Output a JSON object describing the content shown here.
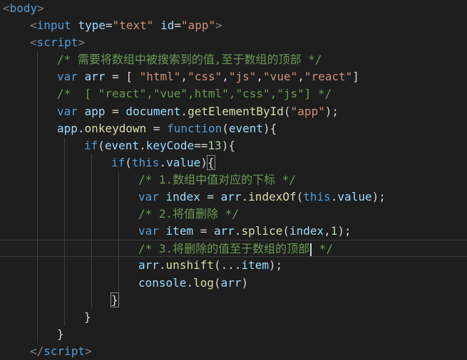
{
  "lines": [
    {
      "indent": 0,
      "tokens": [
        {
          "c": "t-punc",
          "v": "<"
        },
        {
          "c": "t-tag",
          "v": "body"
        },
        {
          "c": "t-punc",
          "v": ">"
        }
      ]
    },
    {
      "indent": 1,
      "tokens": [
        {
          "c": "t-punc",
          "v": "<"
        },
        {
          "c": "t-tag",
          "v": "input"
        },
        {
          "c": "t-plain",
          "v": " "
        },
        {
          "c": "t-attr",
          "v": "type"
        },
        {
          "c": "t-plain",
          "v": "="
        },
        {
          "c": "t-str",
          "v": "\"text\""
        },
        {
          "c": "t-plain",
          "v": " "
        },
        {
          "c": "t-attr",
          "v": "id"
        },
        {
          "c": "t-plain",
          "v": "="
        },
        {
          "c": "t-str",
          "v": "\"app\""
        },
        {
          "c": "t-punc",
          "v": ">"
        }
      ]
    },
    {
      "indent": 1,
      "tokens": [
        {
          "c": "t-punc",
          "v": "<"
        },
        {
          "c": "t-tag",
          "v": "script"
        },
        {
          "c": "t-punc",
          "v": ">"
        }
      ]
    },
    {
      "indent": 2,
      "tokens": [
        {
          "c": "t-cmt",
          "v": "/* 需要将数组中被搜索到的值,至于数组的顶部 */"
        }
      ]
    },
    {
      "indent": 2,
      "tokens": [
        {
          "c": "t-kw",
          "v": "var"
        },
        {
          "c": "t-plain",
          "v": " "
        },
        {
          "c": "t-var",
          "v": "arr"
        },
        {
          "c": "t-plain",
          "v": " = [ "
        },
        {
          "c": "t-str",
          "v": "\"html\""
        },
        {
          "c": "t-plain",
          "v": ","
        },
        {
          "c": "t-str",
          "v": "\"css\""
        },
        {
          "c": "t-plain",
          "v": ","
        },
        {
          "c": "t-str",
          "v": "\"js\""
        },
        {
          "c": "t-plain",
          "v": ","
        },
        {
          "c": "t-str",
          "v": "\"vue\""
        },
        {
          "c": "t-plain",
          "v": ","
        },
        {
          "c": "t-str",
          "v": "\"react\""
        },
        {
          "c": "t-plain",
          "v": "]"
        }
      ]
    },
    {
      "indent": 2,
      "tokens": [
        {
          "c": "t-cmt",
          "v": "/*  [ \"react\",\"vue\",html\",\"css\",\"js\"] */"
        }
      ]
    },
    {
      "indent": 2,
      "tokens": [
        {
          "c": "t-kw",
          "v": "var"
        },
        {
          "c": "t-plain",
          "v": " "
        },
        {
          "c": "t-var",
          "v": "app"
        },
        {
          "c": "t-plain",
          "v": " = "
        },
        {
          "c": "t-var",
          "v": "document"
        },
        {
          "c": "t-plain",
          "v": "."
        },
        {
          "c": "t-fn",
          "v": "getElementById"
        },
        {
          "c": "t-plain",
          "v": "("
        },
        {
          "c": "t-str",
          "v": "\"app\""
        },
        {
          "c": "t-plain",
          "v": ");"
        }
      ]
    },
    {
      "indent": 2,
      "tokens": [
        {
          "c": "t-var",
          "v": "app"
        },
        {
          "c": "t-plain",
          "v": "."
        },
        {
          "c": "t-fn",
          "v": "onkeydown"
        },
        {
          "c": "t-plain",
          "v": " = "
        },
        {
          "c": "t-kw",
          "v": "function"
        },
        {
          "c": "t-plain",
          "v": "("
        },
        {
          "c": "t-var",
          "v": "event"
        },
        {
          "c": "t-plain",
          "v": "){"
        }
      ]
    },
    {
      "indent": 3,
      "tokens": [
        {
          "c": "t-kw",
          "v": "if"
        },
        {
          "c": "t-plain",
          "v": "("
        },
        {
          "c": "t-var",
          "v": "event"
        },
        {
          "c": "t-plain",
          "v": "."
        },
        {
          "c": "t-var",
          "v": "keyCode"
        },
        {
          "c": "t-plain",
          "v": "=="
        },
        {
          "c": "t-num",
          "v": "13"
        },
        {
          "c": "t-plain",
          "v": "){"
        }
      ]
    },
    {
      "indent": 4,
      "tokens": [
        {
          "c": "t-kw",
          "v": "if"
        },
        {
          "c": "t-plain",
          "v": "("
        },
        {
          "c": "t-this",
          "v": "this"
        },
        {
          "c": "t-plain",
          "v": "."
        },
        {
          "c": "t-var",
          "v": "value"
        },
        {
          "c": "t-plain",
          "v": ")"
        },
        {
          "c": "t-plain bracket-box",
          "v": "{"
        }
      ]
    },
    {
      "indent": 5,
      "tokens": [
        {
          "c": "t-cmt",
          "v": "/* 1.数组中值对应的下标 */"
        }
      ]
    },
    {
      "indent": 5,
      "tokens": [
        {
          "c": "t-kw",
          "v": "var"
        },
        {
          "c": "t-plain",
          "v": " "
        },
        {
          "c": "t-var",
          "v": "index"
        },
        {
          "c": "t-plain",
          "v": " = "
        },
        {
          "c": "t-var",
          "v": "arr"
        },
        {
          "c": "t-plain",
          "v": "."
        },
        {
          "c": "t-fn",
          "v": "indexOf"
        },
        {
          "c": "t-plain",
          "v": "("
        },
        {
          "c": "t-this",
          "v": "this"
        },
        {
          "c": "t-plain",
          "v": "."
        },
        {
          "c": "t-var",
          "v": "value"
        },
        {
          "c": "t-plain",
          "v": ");"
        }
      ]
    },
    {
      "indent": 5,
      "tokens": [
        {
          "c": "t-cmt",
          "v": "/* 2.将值删除 */"
        }
      ]
    },
    {
      "indent": 5,
      "tokens": [
        {
          "c": "t-kw",
          "v": "var"
        },
        {
          "c": "t-plain",
          "v": " "
        },
        {
          "c": "t-var",
          "v": "item"
        },
        {
          "c": "t-plain",
          "v": " = "
        },
        {
          "c": "t-var",
          "v": "arr"
        },
        {
          "c": "t-plain",
          "v": "."
        },
        {
          "c": "t-fn",
          "v": "splice"
        },
        {
          "c": "t-plain",
          "v": "("
        },
        {
          "c": "t-var",
          "v": "index"
        },
        {
          "c": "t-plain",
          "v": ","
        },
        {
          "c": "t-num",
          "v": "1"
        },
        {
          "c": "t-plain",
          "v": ");"
        }
      ]
    },
    {
      "indent": 5,
      "current": true,
      "tokens": [
        {
          "c": "t-cmt",
          "v": "/* 3.将删除的值至于数组的顶部"
        },
        {
          "c": "cursor",
          "v": ""
        },
        {
          "c": "t-cmt",
          "v": " */"
        }
      ]
    },
    {
      "indent": 5,
      "tokens": [
        {
          "c": "t-var",
          "v": "arr"
        },
        {
          "c": "t-plain",
          "v": "."
        },
        {
          "c": "t-fn",
          "v": "unshift"
        },
        {
          "c": "t-plain",
          "v": "(..."
        },
        {
          "c": "t-var",
          "v": "item"
        },
        {
          "c": "t-plain",
          "v": ");"
        }
      ]
    },
    {
      "indent": 5,
      "tokens": [
        {
          "c": "t-var",
          "v": "console"
        },
        {
          "c": "t-plain",
          "v": "."
        },
        {
          "c": "t-fn",
          "v": "log"
        },
        {
          "c": "t-plain",
          "v": "("
        },
        {
          "c": "t-var",
          "v": "arr"
        },
        {
          "c": "t-plain",
          "v": ")"
        }
      ]
    },
    {
      "indent": 4,
      "tokens": [
        {
          "c": "t-plain bracket-box",
          "v": "}"
        }
      ]
    },
    {
      "indent": 3,
      "tokens": [
        {
          "c": "t-plain",
          "v": "}"
        }
      ]
    },
    {
      "indent": 2,
      "tokens": [
        {
          "c": "t-plain",
          "v": "}"
        }
      ]
    },
    {
      "indent": 1,
      "tokens": [
        {
          "c": "t-punc",
          "v": "</"
        },
        {
          "c": "t-tag",
          "v": "script"
        },
        {
          "c": "t-punc",
          "v": ">"
        }
      ]
    }
  ]
}
